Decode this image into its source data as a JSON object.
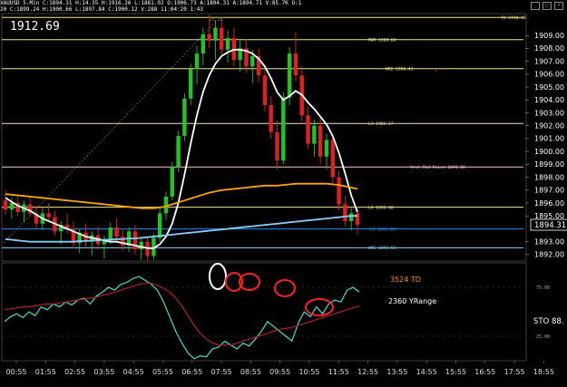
{
  "header": {
    "line1": "XAUUSD 5-Min  C:1894.31  H:14.35  H:1916.26  L:1881.02  O:1906.73  A:1894.31  A:1894.71  V:85.7K  O:1",
    "line2": "20  C:1899.24  H:1900.66  L:1897.84  C:1900.12  V:288  11:04:20  1:43"
  },
  "last_price_big": "1912.69",
  "window_icons": [
    "minimize-icon",
    "restore-icon",
    "close-icon"
  ],
  "chart_data": [
    {
      "type": "candlestick",
      "panel": "price",
      "title": "",
      "x_tick_labels": [
        "00:55",
        "01:55",
        "02:55",
        "03:55",
        "04:55",
        "05:55",
        "06:55",
        "07:55",
        "08:55",
        "09:55",
        "10:55",
        "11:55",
        "12:55",
        "13:55",
        "14:55",
        "15:55",
        "16:55",
        "17:55",
        "18:55"
      ],
      "y_tick_labels": [
        "1909.00",
        "1908.00",
        "1907.00",
        "1906.00",
        "1905.00",
        "1904.00",
        "1903.00",
        "1902.00",
        "1901.00",
        "1900.00",
        "1899.00",
        "1898.00",
        "1897.00",
        "1896.00",
        "1895.00",
        "1893.00",
        "1892.00"
      ],
      "ylim": [
        1891.5,
        1910.7
      ],
      "current_price_label": "1894.31",
      "candles": [
        [
          1896.2,
          1897.0,
          1895.1,
          1895.5
        ],
        [
          1895.5,
          1896.4,
          1894.8,
          1896.0
        ],
        [
          1896.0,
          1896.6,
          1895.0,
          1895.3
        ],
        [
          1895.3,
          1896.2,
          1894.5,
          1895.9
        ],
        [
          1895.9,
          1896.5,
          1895.0,
          1895.2
        ],
        [
          1895.2,
          1895.8,
          1894.0,
          1894.4
        ],
        [
          1894.4,
          1895.6,
          1893.9,
          1895.2
        ],
        [
          1895.2,
          1896.0,
          1894.6,
          1894.9
        ],
        [
          1894.9,
          1895.4,
          1893.5,
          1893.8
        ],
        [
          1893.8,
          1894.6,
          1892.8,
          1894.3
        ],
        [
          1894.3,
          1895.2,
          1893.6,
          1894.0
        ],
        [
          1894.0,
          1894.6,
          1892.5,
          1892.9
        ],
        [
          1892.9,
          1894.0,
          1892.1,
          1893.7
        ],
        [
          1893.7,
          1894.4,
          1892.6,
          1893.0
        ],
        [
          1893.0,
          1893.8,
          1891.9,
          1893.5
        ],
        [
          1893.5,
          1894.2,
          1892.4,
          1892.8
        ],
        [
          1892.8,
          1893.5,
          1891.7,
          1893.2
        ],
        [
          1893.2,
          1894.5,
          1892.8,
          1894.1
        ],
        [
          1894.1,
          1894.8,
          1893.0,
          1893.4
        ],
        [
          1893.4,
          1894.0,
          1892.3,
          1892.7
        ],
        [
          1892.7,
          1894.1,
          1892.2,
          1893.8
        ],
        [
          1893.8,
          1894.3,
          1892.0,
          1892.4
        ],
        [
          1892.4,
          1893.4,
          1891.6,
          1893.0
        ],
        [
          1893.0,
          1893.3,
          1891.5,
          1891.9
        ],
        [
          1891.9,
          1893.6,
          1891.6,
          1893.3
        ],
        [
          1893.3,
          1895.6,
          1893.0,
          1895.2
        ],
        [
          1895.2,
          1896.9,
          1894.7,
          1896.5
        ],
        [
          1896.5,
          1899.2,
          1896.2,
          1898.8
        ],
        [
          1898.8,
          1901.6,
          1898.4,
          1901.2
        ],
        [
          1901.2,
          1904.5,
          1900.8,
          1904.1
        ],
        [
          1904.1,
          1906.8,
          1903.6,
          1906.4
        ],
        [
          1906.4,
          1908.2,
          1905.2,
          1907.6
        ],
        [
          1907.6,
          1909.6,
          1906.7,
          1909.1
        ],
        [
          1909.1,
          1910.6,
          1908.0,
          1908.6
        ],
        [
          1908.6,
          1910.2,
          1907.1,
          1909.6
        ],
        [
          1909.6,
          1910.4,
          1907.4,
          1907.9
        ],
        [
          1907.9,
          1909.4,
          1906.9,
          1908.8
        ],
        [
          1908.8,
          1909.6,
          1906.6,
          1907.1
        ],
        [
          1907.1,
          1908.6,
          1906.2,
          1908.0
        ],
        [
          1908.0,
          1908.7,
          1906.1,
          1906.6
        ],
        [
          1906.6,
          1907.9,
          1905.3,
          1907.4
        ],
        [
          1907.4,
          1908.0,
          1905.4,
          1905.9
        ],
        [
          1905.9,
          1906.6,
          1903.1,
          1903.6
        ],
        [
          1903.6,
          1904.3,
          1901.0,
          1901.5
        ],
        [
          1901.5,
          1902.4,
          1898.6,
          1899.3
        ],
        [
          1899.3,
          1904.6,
          1899.0,
          1904.2
        ],
        [
          1904.2,
          1908.1,
          1903.6,
          1907.6
        ],
        [
          1907.6,
          1909.3,
          1905.4,
          1905.9
        ],
        [
          1905.9,
          1906.6,
          1902.3,
          1902.8
        ],
        [
          1902.8,
          1903.5,
          1900.2,
          1900.6
        ],
        [
          1900.6,
          1902.5,
          1899.6,
          1902.0
        ],
        [
          1902.0,
          1902.6,
          1899.0,
          1899.6
        ],
        [
          1899.6,
          1901.4,
          1898.6,
          1900.9
        ],
        [
          1900.9,
          1901.3,
          1897.4,
          1898.0
        ],
        [
          1898.0,
          1898.5,
          1895.4,
          1895.9
        ],
        [
          1895.9,
          1896.6,
          1894.2,
          1894.6
        ],
        [
          1894.6,
          1895.6,
          1893.9,
          1895.2
        ],
        [
          1895.2,
          1895.7,
          1893.5,
          1894.31
        ]
      ],
      "moving_averages": [
        {
          "color": "#ffffff",
          "values": [
            1896.4,
            1896.1,
            1895.8,
            1895.6,
            1895.4,
            1895.1,
            1894.8,
            1894.6,
            1894.4,
            1894.2,
            1894.0,
            1893.8,
            1893.6,
            1893.4,
            1893.3,
            1893.2,
            1893.1,
            1893.0,
            1893.0,
            1892.9,
            1892.8,
            1892.7,
            1892.6,
            1892.5,
            1892.5,
            1892.8,
            1893.4,
            1894.4,
            1896.0,
            1898.2,
            1900.6,
            1902.8,
            1904.6,
            1905.9,
            1906.8,
            1907.4,
            1907.7,
            1907.9,
            1907.9,
            1907.8,
            1907.6,
            1907.2,
            1906.6,
            1905.7,
            1904.6,
            1904.0,
            1904.3,
            1904.7,
            1904.4,
            1903.8,
            1903.3,
            1902.7,
            1902.1,
            1901.2,
            1899.9,
            1898.3,
            1896.6,
            1895.3
          ]
        },
        {
          "color": "#ffa500",
          "values": [
            1896.7,
            1896.65,
            1896.6,
            1896.55,
            1896.5,
            1896.45,
            1896.4,
            1896.35,
            1896.3,
            1896.25,
            1896.2,
            1896.15,
            1896.1,
            1896.05,
            1896.0,
            1895.95,
            1895.9,
            1895.85,
            1895.8,
            1895.75,
            1895.7,
            1895.65,
            1895.6,
            1895.6,
            1895.6,
            1895.65,
            1895.75,
            1895.9,
            1896.05,
            1896.2,
            1896.35,
            1896.5,
            1896.65,
            1896.8,
            1896.9,
            1897.0,
            1897.05,
            1897.1,
            1897.15,
            1897.2,
            1897.25,
            1897.3,
            1897.35,
            1897.35,
            1897.35,
            1897.4,
            1897.45,
            1897.5,
            1897.5,
            1897.5,
            1897.5,
            1897.5,
            1897.5,
            1897.45,
            1897.4,
            1897.3,
            1897.2,
            1897.1
          ]
        },
        {
          "color": "#87cefa",
          "values": [
            1893.2,
            1893.15,
            1893.1,
            1893.05,
            1893.0,
            1893.0,
            1893.0,
            1893.0,
            1893.0,
            1893.0,
            1893.0,
            1893.0,
            1893.05,
            1893.05,
            1893.1,
            1893.1,
            1893.15,
            1893.15,
            1893.2,
            1893.2,
            1893.25,
            1893.25,
            1893.3,
            1893.35,
            1893.4,
            1893.45,
            1893.5,
            1893.55,
            1893.6,
            1893.65,
            1893.7,
            1893.75,
            1893.8,
            1893.85,
            1893.9,
            1893.95,
            1894.0,
            1894.05,
            1894.1,
            1894.15,
            1894.2,
            1894.25,
            1894.3,
            1894.35,
            1894.4,
            1894.45,
            1894.5,
            1894.55,
            1894.6,
            1894.65,
            1894.7,
            1894.75,
            1894.8,
            1894.85,
            1894.9,
            1894.95,
            1895.0,
            1895.0
          ]
        }
      ],
      "levels": [
        {
          "label": "YH 1910.40",
          "price": 1910.4,
          "color": "#f0e68c"
        },
        {
          "label": "MWR 1908.68",
          "price": 1908.68,
          "color": "#f0e68c"
        },
        {
          "label": "WRI 1906.43",
          "price": 1906.43,
          "color": "#f0e68c"
        },
        {
          "label": "L3 1902.17",
          "price": 1902.17,
          "color": "#f5deb3"
        },
        {
          "label": "Yest Mid Point 1898.80",
          "price": 1898.8,
          "color": "#ffc0cb"
        },
        {
          "label": "L4 1895.68",
          "price": 1895.68,
          "color": "#f0e68c"
        },
        {
          "label": "L5 1893.99",
          "price": 1893.99,
          "color": "#1e90ff"
        },
        {
          "label": "WRI 1892.53",
          "price": 1892.53,
          "color": "#87cefa"
        }
      ],
      "peak_label": "29.35"
    },
    {
      "type": "line",
      "panel": "indicator",
      "title": "",
      "indicator_label": "STO",
      "indicator_value": "88.",
      "y_tick_labels": [
        "25.00",
        "75.00"
      ],
      "ylim": [
        0,
        100
      ],
      "annotations": [
        "3524 TD",
        "2360 YRange"
      ],
      "series": [
        {
          "color": "#40e0d0",
          "values": [
            40,
            45,
            48,
            44,
            50,
            46,
            55,
            52,
            58,
            55,
            60,
            57,
            62,
            64,
            58,
            66,
            70,
            75,
            72,
            78,
            80,
            84,
            86,
            82,
            78,
            72,
            60,
            45,
            30,
            18,
            8,
            2,
            5,
            4,
            12,
            14,
            20,
            16,
            12,
            18,
            15,
            22,
            30,
            40,
            35,
            30,
            25,
            20,
            38,
            50,
            45,
            55,
            48,
            58,
            62,
            60,
            72,
            75,
            70
          ]
        },
        {
          "color": "#b22222",
          "values": [
            52,
            53,
            54,
            55,
            55,
            56,
            57,
            58,
            58,
            59,
            60,
            61,
            62,
            63,
            64,
            65,
            67,
            68,
            70,
            72,
            74,
            76,
            78,
            79,
            79,
            77,
            74,
            70,
            64,
            56,
            46,
            36,
            28,
            22,
            18,
            16,
            16,
            16,
            18,
            20,
            22,
            24,
            26,
            28,
            30,
            32,
            33,
            34,
            36,
            38,
            40,
            42,
            44,
            46,
            48,
            50,
            52,
            54,
            56
          ]
        }
      ],
      "highlighted_points": [
        8,
        11,
        14,
        22,
        40
      ],
      "highlight_colors": [
        "#ffffff",
        "#ff2020",
        "#ff2020",
        "#ff2020",
        "#ff2020"
      ]
    }
  ]
}
